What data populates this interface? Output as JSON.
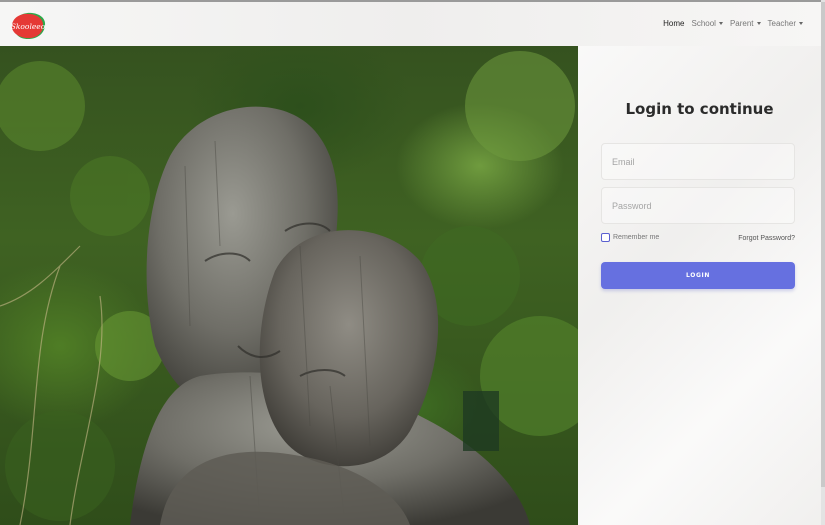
{
  "brand": {
    "logo_text": "Skooleeo",
    "colors": {
      "red": "#e53935",
      "green": "#2ea84a"
    }
  },
  "nav": {
    "items": [
      {
        "label": "Home",
        "active": true,
        "dropdown": false
      },
      {
        "label": "School",
        "active": false,
        "dropdown": true
      },
      {
        "label": "Parent",
        "active": false,
        "dropdown": true
      },
      {
        "label": "Teacher",
        "active": false,
        "dropdown": true
      }
    ]
  },
  "hero": {
    "icon": "statue-photo"
  },
  "login": {
    "title": "Login to continue",
    "email_placeholder": "Email",
    "password_placeholder": "Password",
    "remember_label": "Remember me",
    "remember_checked": false,
    "forgot_label": "Forgot Password?",
    "button_label": "LOGIN",
    "button_color": "#6670e0"
  }
}
